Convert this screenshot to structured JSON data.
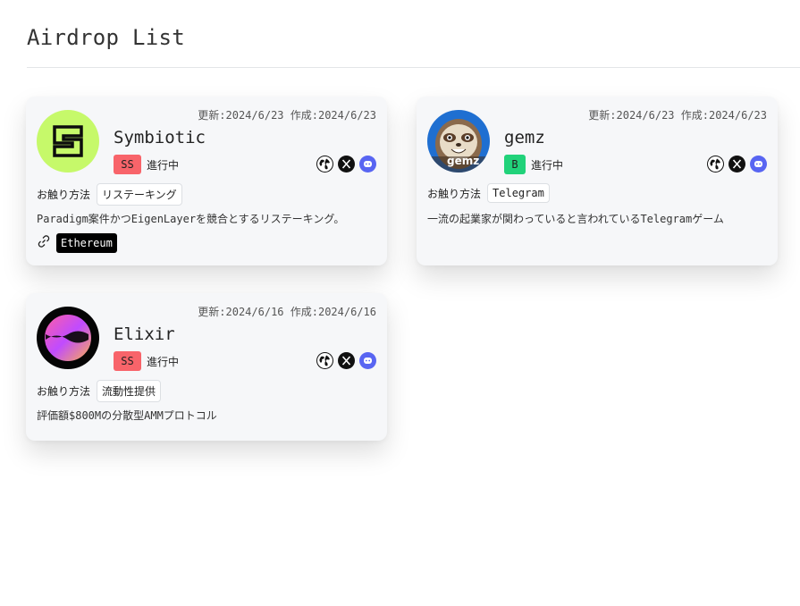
{
  "page": {
    "title": "Airdrop List"
  },
  "cards": [
    {
      "name": "Symbiotic",
      "updated": "更新:2024/6/23",
      "created": "作成:2024/6/23",
      "grade": "SS",
      "grade_color": "#f8646a",
      "status": "進行中",
      "method_label": "お触り方法",
      "method": "リステーキング",
      "description": "Paradigm案件かつEigenLayerを競合とするリステーキング。",
      "chain": "Ethereum",
      "logo_icon": "symbiotic-logo"
    },
    {
      "name": "gemz",
      "updated": "更新:2024/6/23",
      "created": "作成:2024/6/23",
      "grade": "B",
      "grade_color": "#21d27a",
      "status": "進行中",
      "method_label": "お触り方法",
      "method": "Telegram",
      "description": "一流の起業家が関わっていると言われているTelegramゲーム",
      "logo_icon": "gemz-sloth-logo",
      "logo_text": "gemz"
    },
    {
      "name": "Elixir",
      "updated": "更新:2024/6/16",
      "created": "作成:2024/6/16",
      "grade": "SS",
      "grade_color": "#f8646a",
      "status": "進行中",
      "method_label": "お触り方法",
      "method": "流動性提供",
      "description": "評価額$800Mの分散型AMMプロトコル",
      "logo_icon": "elixir-logo"
    }
  ],
  "social_icons": [
    "globe-icon",
    "x-icon",
    "discord-icon"
  ]
}
